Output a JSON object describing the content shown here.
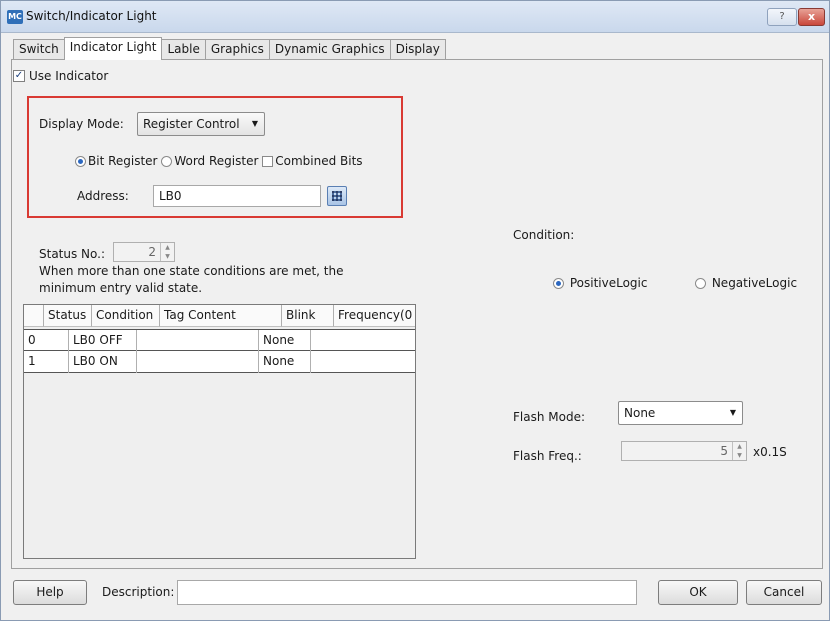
{
  "window": {
    "app_icon": "MC",
    "title": "Switch/Indicator Light",
    "help_glyph": "?",
    "close_glyph": "x"
  },
  "tabs": [
    "Switch",
    "Indicator Light",
    "Lable",
    "Graphics",
    "Dynamic Graphics",
    "Display"
  ],
  "active_tab": "Indicator Light",
  "use_indicator": {
    "label": "Use Indicator",
    "checked": true
  },
  "display_mode": {
    "label": "Display Mode:",
    "value": "Register Control"
  },
  "register_type": {
    "options": [
      "Bit Register",
      "Word Register",
      "Combined Bits"
    ],
    "selected": "Bit Register"
  },
  "address": {
    "label": "Address:",
    "value": "LB0",
    "icon": "register-picker-icon"
  },
  "status_no": {
    "label": "Status No.:",
    "value": "2"
  },
  "note": [
    "When more than one state conditions are met, the",
    "minimum entry valid state."
  ],
  "table": {
    "columns": [
      "Status",
      "Condition",
      "Tag Content",
      "Blink",
      "Frequency(0"
    ],
    "rows": [
      [
        "0",
        "LB0 OFF",
        "",
        "None",
        ""
      ],
      [
        "1",
        "LB0 ON",
        "",
        "None",
        ""
      ]
    ]
  },
  "condition": {
    "label": "Condition:",
    "options": [
      "PositiveLogic",
      "NegativeLogic"
    ],
    "selected": "PositiveLogic"
  },
  "flash": {
    "mode_label": "Flash Mode:",
    "mode_value": "None",
    "freq_label": "Flash Freq.:",
    "freq_value": "5",
    "freq_unit": "x0.1S"
  },
  "footer": {
    "help": "Help",
    "description_label": "Description:",
    "description_value": "",
    "ok": "OK",
    "cancel": "Cancel"
  },
  "colors": {
    "highlight_border": "#d93a33",
    "radio_selected": "#2b67c0"
  }
}
